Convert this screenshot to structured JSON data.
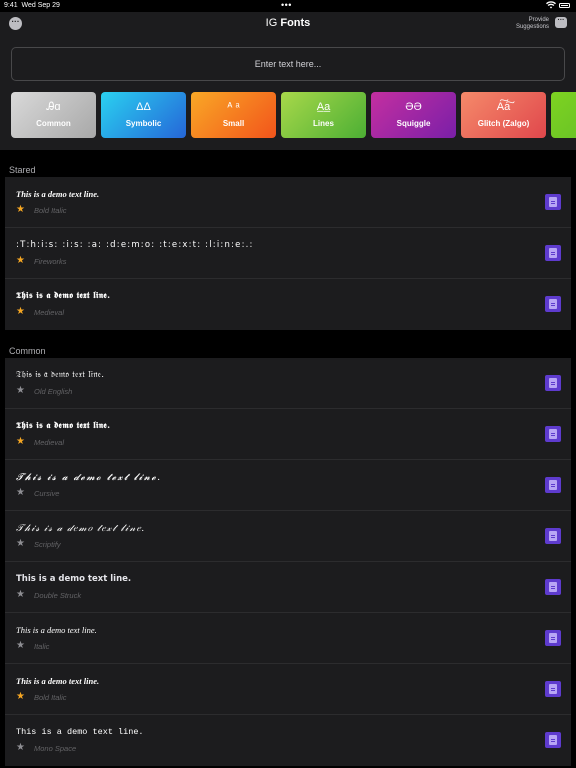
{
  "status": {
    "time": "9:41",
    "date": "Wed Sep 29",
    "dots": "•••"
  },
  "nav": {
    "title_prefix": "IG",
    "title_bold": "Fonts",
    "more_icon": "ellipsis-circle-icon",
    "suggest_line1": "Provide",
    "suggest_line2": "Suggestions",
    "suggest_icon": "chat-bubble-icon"
  },
  "input": {
    "placeholder": "Enter text here..."
  },
  "categories": [
    {
      "glyph": "Ꭿɑ",
      "label": "Common",
      "gradient": [
        "#d9d9d9",
        "#a8a8a8"
      ]
    },
    {
      "glyph": "ΔΔ",
      "label": "Symbolic",
      "gradient": [
        "#2ad1f0",
        "#2566d8"
      ]
    },
    {
      "glyph": "ᴬ ᵃ",
      "label": "Small",
      "gradient": [
        "#f9a826",
        "#f2541b"
      ]
    },
    {
      "glyph": "A̲a̲",
      "label": "Lines",
      "gradient": [
        "#a8d84a",
        "#4caf34"
      ]
    },
    {
      "glyph": "ƏƏ",
      "label": "Squiggle",
      "gradient": [
        "#c42fa0",
        "#7a1fa8"
      ]
    },
    {
      "glyph": "A͠a͠",
      "label": "Glitch (Zalgo)",
      "gradient": [
        "#f58a6a",
        "#e0474c"
      ]
    },
    {
      "glyph": "",
      "label": "",
      "gradient": [
        "#7ed321",
        "#5cb82a"
      ]
    }
  ],
  "sections": {
    "stared": "Stared",
    "common": "Common"
  },
  "stared_rows": [
    {
      "sample": "This is a demo text line.",
      "font": "Bold Italic",
      "starred": true,
      "style": "s-bolditalic"
    },
    {
      "sample": "꞉T꞉h꞉i꞉s꞉ ꞉i꞉s꞉ ꞉a꞉ ꞉d꞉e꞉m꞉o꞉ ꞉t꞉e꞉x꞉t꞉ ꞉l꞉i꞉n꞉e꞉.꞉",
      "font": "Fireworks",
      "starred": true,
      "style": "s-fireworks"
    },
    {
      "sample": "𝕿𝖍𝖎𝖘 𝖎𝖘 𝖆 𝖉𝖊𝖒𝖔 𝖙𝖊𝖝𝖙 𝖑𝖎𝖓𝖊.",
      "font": "Medieval",
      "starred": true,
      "style": "s-medieval"
    }
  ],
  "common_rows": [
    {
      "sample": "𝔗𝔥𝔦𝔰 𝔦𝔰 𝔞 𝔡𝔢𝔪𝔬 𝔱𝔢𝔵𝔱 𝔩𝔦𝔫𝔢.",
      "font": "Old English",
      "starred": false,
      "style": "s-oldenglish"
    },
    {
      "sample": "𝕿𝖍𝖎𝖘 𝖎𝖘 𝖆 𝖉𝖊𝖒𝖔 𝖙𝖊𝖝𝖙 𝖑𝖎𝖓𝖊.",
      "font": "Medieval",
      "starred": true,
      "style": "s-medieval"
    },
    {
      "sample": "𝓣𝓱𝓲𝓼 𝓲𝓼 𝓪 𝓭𝓮𝓶𝓸 𝓽𝓮𝔁𝓽 𝓵𝓲𝓷𝓮.",
      "font": "Cursive",
      "starred": false,
      "style": "s-cursive"
    },
    {
      "sample": "𝒯𝒽𝒾𝓈 𝒾𝓈 𝒶 𝒹𝑒𝓂𝑜 𝓉𝑒𝓍𝓉 𝓁𝒾𝓃𝑒.",
      "font": "Scriptify",
      "starred": false,
      "style": "s-scriptify"
    },
    {
      "sample": "This is a demo text line.",
      "font": "Double Struck",
      "starred": false,
      "style": "s-double"
    },
    {
      "sample": "This is a demo text line.",
      "font": "Italic",
      "starred": false,
      "style": "s-italic"
    },
    {
      "sample": "This is a demo text line.",
      "font": "Bold Italic",
      "starred": true,
      "style": "s-bolditalic"
    },
    {
      "sample": "This is a demo text line.",
      "font": "Mono Space",
      "starred": false,
      "style": "s-mono"
    }
  ],
  "icons": {
    "star": "★",
    "copy": "copy-document-icon"
  },
  "colors": {
    "accent": "#5e3bce",
    "star_on": "#f5a623",
    "star_off": "#8e8e93",
    "surface": "#1c1c1e"
  }
}
